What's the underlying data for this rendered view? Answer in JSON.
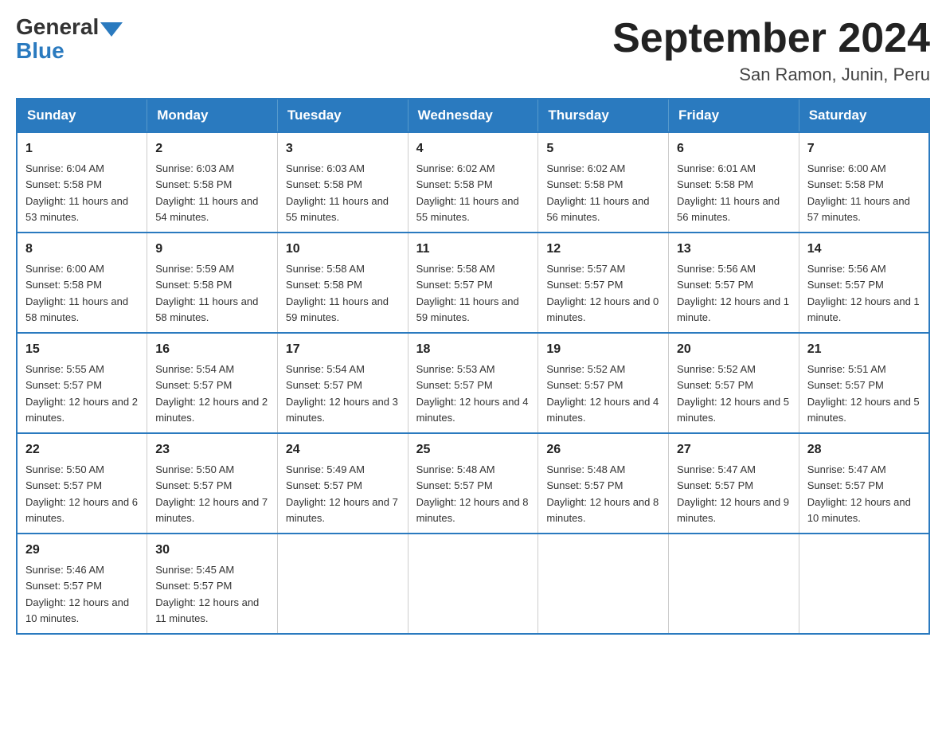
{
  "logo": {
    "general": "General",
    "blue": "Blue"
  },
  "title": "September 2024",
  "location": "San Ramon, Junin, Peru",
  "days_header": [
    "Sunday",
    "Monday",
    "Tuesday",
    "Wednesday",
    "Thursday",
    "Friday",
    "Saturday"
  ],
  "weeks": [
    [
      {
        "day": "1",
        "sunrise": "6:04 AM",
        "sunset": "5:58 PM",
        "daylight": "11 hours and 53 minutes."
      },
      {
        "day": "2",
        "sunrise": "6:03 AM",
        "sunset": "5:58 PM",
        "daylight": "11 hours and 54 minutes."
      },
      {
        "day": "3",
        "sunrise": "6:03 AM",
        "sunset": "5:58 PM",
        "daylight": "11 hours and 55 minutes."
      },
      {
        "day": "4",
        "sunrise": "6:02 AM",
        "sunset": "5:58 PM",
        "daylight": "11 hours and 55 minutes."
      },
      {
        "day": "5",
        "sunrise": "6:02 AM",
        "sunset": "5:58 PM",
        "daylight": "11 hours and 56 minutes."
      },
      {
        "day": "6",
        "sunrise": "6:01 AM",
        "sunset": "5:58 PM",
        "daylight": "11 hours and 56 minutes."
      },
      {
        "day": "7",
        "sunrise": "6:00 AM",
        "sunset": "5:58 PM",
        "daylight": "11 hours and 57 minutes."
      }
    ],
    [
      {
        "day": "8",
        "sunrise": "6:00 AM",
        "sunset": "5:58 PM",
        "daylight": "11 hours and 58 minutes."
      },
      {
        "day": "9",
        "sunrise": "5:59 AM",
        "sunset": "5:58 PM",
        "daylight": "11 hours and 58 minutes."
      },
      {
        "day": "10",
        "sunrise": "5:58 AM",
        "sunset": "5:58 PM",
        "daylight": "11 hours and 59 minutes."
      },
      {
        "day": "11",
        "sunrise": "5:58 AM",
        "sunset": "5:57 PM",
        "daylight": "11 hours and 59 minutes."
      },
      {
        "day": "12",
        "sunrise": "5:57 AM",
        "sunset": "5:57 PM",
        "daylight": "12 hours and 0 minutes."
      },
      {
        "day": "13",
        "sunrise": "5:56 AM",
        "sunset": "5:57 PM",
        "daylight": "12 hours and 1 minute."
      },
      {
        "day": "14",
        "sunrise": "5:56 AM",
        "sunset": "5:57 PM",
        "daylight": "12 hours and 1 minute."
      }
    ],
    [
      {
        "day": "15",
        "sunrise": "5:55 AM",
        "sunset": "5:57 PM",
        "daylight": "12 hours and 2 minutes."
      },
      {
        "day": "16",
        "sunrise": "5:54 AM",
        "sunset": "5:57 PM",
        "daylight": "12 hours and 2 minutes."
      },
      {
        "day": "17",
        "sunrise": "5:54 AM",
        "sunset": "5:57 PM",
        "daylight": "12 hours and 3 minutes."
      },
      {
        "day": "18",
        "sunrise": "5:53 AM",
        "sunset": "5:57 PM",
        "daylight": "12 hours and 4 minutes."
      },
      {
        "day": "19",
        "sunrise": "5:52 AM",
        "sunset": "5:57 PM",
        "daylight": "12 hours and 4 minutes."
      },
      {
        "day": "20",
        "sunrise": "5:52 AM",
        "sunset": "5:57 PM",
        "daylight": "12 hours and 5 minutes."
      },
      {
        "day": "21",
        "sunrise": "5:51 AM",
        "sunset": "5:57 PM",
        "daylight": "12 hours and 5 minutes."
      }
    ],
    [
      {
        "day": "22",
        "sunrise": "5:50 AM",
        "sunset": "5:57 PM",
        "daylight": "12 hours and 6 minutes."
      },
      {
        "day": "23",
        "sunrise": "5:50 AM",
        "sunset": "5:57 PM",
        "daylight": "12 hours and 7 minutes."
      },
      {
        "day": "24",
        "sunrise": "5:49 AM",
        "sunset": "5:57 PM",
        "daylight": "12 hours and 7 minutes."
      },
      {
        "day": "25",
        "sunrise": "5:48 AM",
        "sunset": "5:57 PM",
        "daylight": "12 hours and 8 minutes."
      },
      {
        "day": "26",
        "sunrise": "5:48 AM",
        "sunset": "5:57 PM",
        "daylight": "12 hours and 8 minutes."
      },
      {
        "day": "27",
        "sunrise": "5:47 AM",
        "sunset": "5:57 PM",
        "daylight": "12 hours and 9 minutes."
      },
      {
        "day": "28",
        "sunrise": "5:47 AM",
        "sunset": "5:57 PM",
        "daylight": "12 hours and 10 minutes."
      }
    ],
    [
      {
        "day": "29",
        "sunrise": "5:46 AM",
        "sunset": "5:57 PM",
        "daylight": "12 hours and 10 minutes."
      },
      {
        "day": "30",
        "sunrise": "5:45 AM",
        "sunset": "5:57 PM",
        "daylight": "12 hours and 11 minutes."
      },
      null,
      null,
      null,
      null,
      null
    ]
  ]
}
